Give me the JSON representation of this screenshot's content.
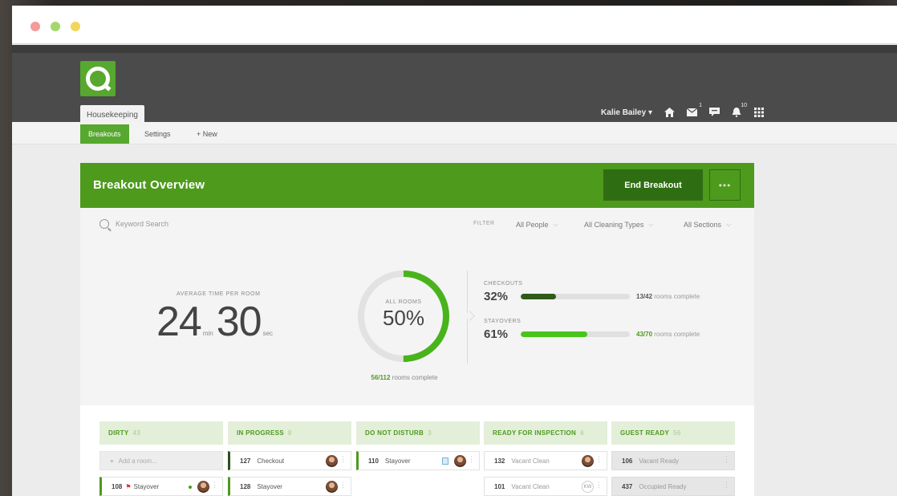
{
  "window": {
    "dots": [
      "close",
      "minimize",
      "zoom"
    ]
  },
  "app": {
    "module_tab": "Housekeeping",
    "user_name": "Kalie Bailey",
    "user_caret": "▾",
    "badge_mail": "1",
    "badge_bell": "10"
  },
  "subnav": {
    "tabs": [
      "Breakouts",
      "Settings",
      "+ New"
    ]
  },
  "panel": {
    "title": "Breakout Overview",
    "end_button": "End Breakout",
    "more_button": "•••"
  },
  "filters": {
    "search_placeholder": "Keyword Search",
    "filter_label": "FILTER",
    "dropdowns": [
      "All People",
      "All Cleaning Types",
      "All Sections"
    ]
  },
  "metrics": {
    "avg_label": "AVERAGE TIME PER ROOM",
    "minutes": "24",
    "min_unit": "min",
    "seconds": "30",
    "sec_unit": "sec",
    "ring_label": "ALL ROOMS",
    "ring_percent": "50%",
    "ring_fraction": 0.5,
    "ring_complete_count": "56/112",
    "ring_complete_text": "rooms complete",
    "checkouts": {
      "label": "CHECKOUTS",
      "pct": "32%",
      "fraction": 0.32,
      "count": "13/42",
      "text": "rooms complete",
      "color": "#2f5a17"
    },
    "stayovers": {
      "label": "STAYOVERS",
      "pct": "61%",
      "fraction": 0.61,
      "count": "43/70",
      "text": "rooms complete",
      "color": "#49c41b"
    }
  },
  "colors": {
    "brand": "#4d9a1d",
    "brand_dark": "#2f6d13",
    "ring_track": "#e2e2e2"
  },
  "board": {
    "columns": [
      {
        "name": "DIRTY",
        "count": "43"
      },
      {
        "name": "IN PROGRESS",
        "count": "8"
      },
      {
        "name": "DO NOT DISTURB",
        "count": "3"
      },
      {
        "name": "READY FOR INSPECTION",
        "count": "6"
      },
      {
        "name": "GUEST READY",
        "count": "56"
      }
    ],
    "add_room_placeholder": "Add a room...",
    "cards": {
      "dirty_1": {
        "room": "108",
        "type": "Stayover"
      },
      "prog_1": {
        "room": "127",
        "type": "Checkout"
      },
      "prog_2": {
        "room": "128",
        "type": "Stayover"
      },
      "dnd_1": {
        "room": "110",
        "type": "Stayover"
      },
      "insp_1": {
        "room": "132",
        "type": "Vacant Clean"
      },
      "insp_2": {
        "room": "101",
        "type": "Vacant Clean",
        "initials": "KW"
      },
      "ready_1": {
        "room": "106",
        "type": "Vacant Ready"
      },
      "ready_2": {
        "room": "437",
        "type": "Occupied Ready"
      }
    }
  }
}
